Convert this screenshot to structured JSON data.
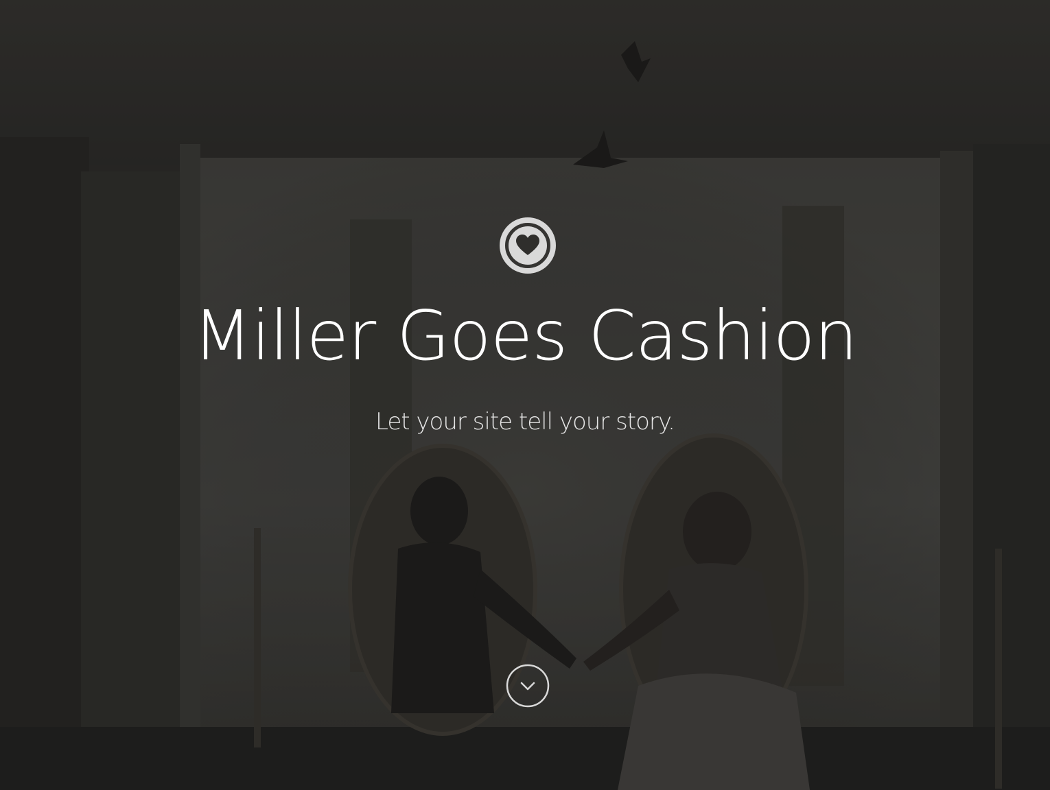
{
  "hero": {
    "title": "Miller Goes Cashion",
    "tagline": "Let your site tell your story.",
    "logo_icon": "heart-in-circle-icon",
    "scroll_icon": "chevron-down-circle-icon",
    "text_color": "#ffffff",
    "icon_color": "#d9d9d9"
  }
}
